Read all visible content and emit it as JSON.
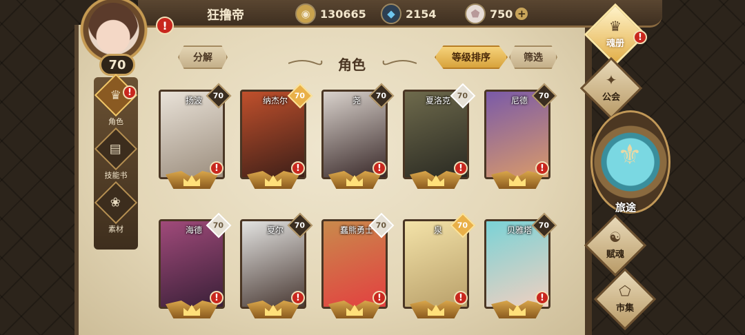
{
  "player": {
    "name": "狂撸帝",
    "level": "70"
  },
  "currencies": [
    {
      "icon": "gold-coin-icon",
      "value": "130665",
      "color": "#c9a34e"
    },
    {
      "icon": "blue-crystal-icon",
      "value": "2154",
      "color": "#4aa6d9"
    },
    {
      "icon": "pink-gem-icon",
      "value": "750",
      "color": "#d7c1c1",
      "plus": "+"
    }
  ],
  "alerts": {
    "mark": "!"
  },
  "left_tabs": [
    {
      "label": "角色",
      "icon": "character-icon"
    },
    {
      "label": "技能书",
      "icon": "skill-book-icon"
    },
    {
      "label": "素材",
      "icon": "material-icon"
    }
  ],
  "toolbar": {
    "decompose": "分解",
    "title": "角色",
    "sort_by_level": "等级排序",
    "filter": "筛选"
  },
  "cards": [
    {
      "name": "扬波",
      "level": "70",
      "badge": "dark",
      "colors": [
        "#e9e2d8",
        "#9c8e7e"
      ]
    },
    {
      "name": "纳杰尔",
      "level": "70",
      "badge": "gold",
      "colors": [
        "#c0502c",
        "#3d1f18"
      ]
    },
    {
      "name": "尧",
      "level": "70",
      "badge": "dark",
      "colors": [
        "#d9d2cc",
        "#3a2a2a"
      ]
    },
    {
      "name": "夏洛克",
      "level": "70",
      "badge": "silver",
      "colors": [
        "#6e6a4c",
        "#2a2a22"
      ]
    },
    {
      "name": "尼德",
      "level": "70",
      "badge": "dark",
      "colors": [
        "#7a5aa8",
        "#d99a6a"
      ]
    },
    {
      "name": "海德",
      "level": "70",
      "badge": "silver",
      "colors": [
        "#a04a7a",
        "#3a2038"
      ]
    },
    {
      "name": "夏尔",
      "level": "70",
      "badge": "dark",
      "colors": [
        "#e2e2e0",
        "#4a3a34"
      ]
    },
    {
      "name": "蠢熊勇士",
      "level": "70",
      "badge": "silver",
      "colors": [
        "#c98a4c",
        "#e34040"
      ]
    },
    {
      "name": "泉",
      "level": "70",
      "badge": "gold",
      "colors": [
        "#f3e2a8",
        "#b9a06a"
      ]
    },
    {
      "name": "贝雅塔",
      "level": "70",
      "badge": "dark",
      "colors": [
        "#7ad2d6",
        "#f0d0c0"
      ]
    }
  ],
  "right_nav": [
    {
      "label": "魂册",
      "icon": "soul-book-icon",
      "active": true
    },
    {
      "label": "公会",
      "icon": "guild-icon"
    },
    {
      "label": "旅途",
      "icon": "journey-icon"
    },
    {
      "label": "赋魂",
      "icon": "soul-infuse-icon"
    },
    {
      "label": "市集",
      "icon": "market-icon"
    }
  ]
}
